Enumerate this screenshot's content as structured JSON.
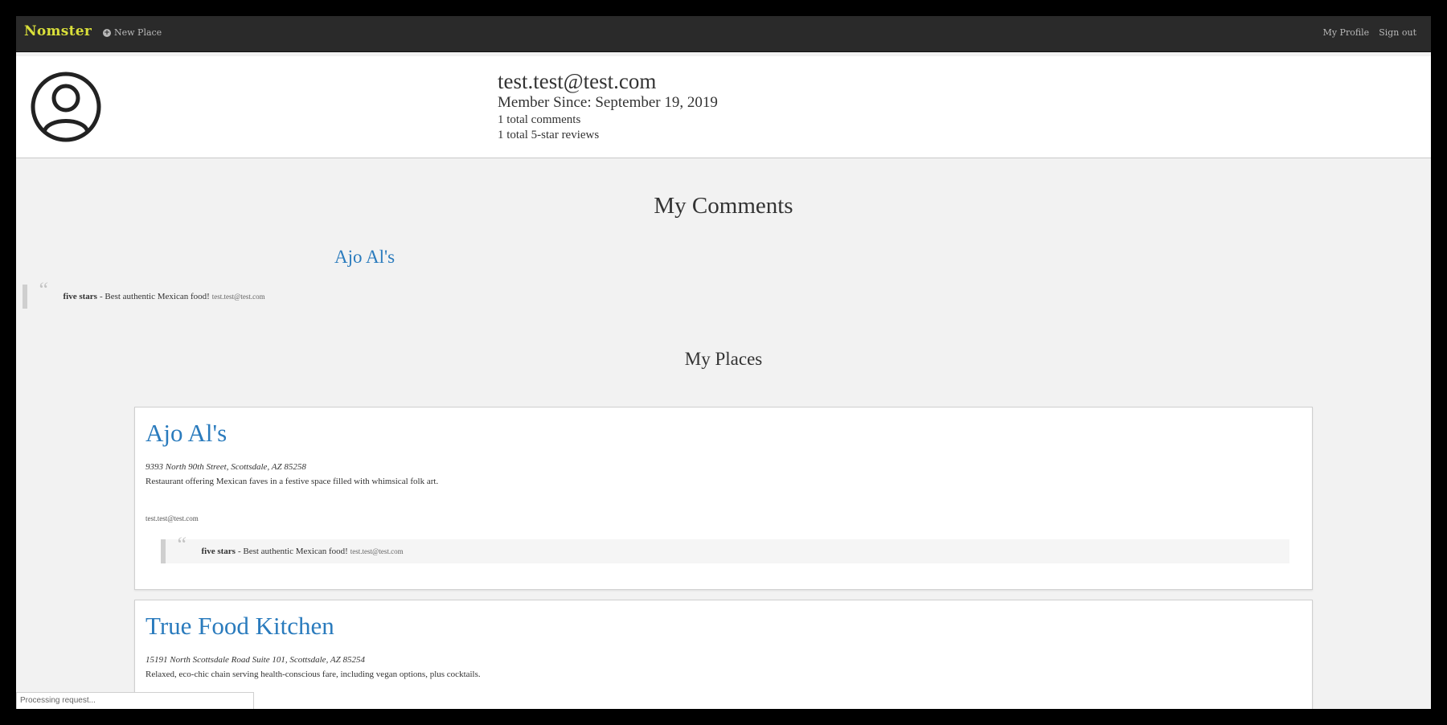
{
  "nav": {
    "brand": "Nomster",
    "new_place": "New Place",
    "my_profile": "My Profile",
    "sign_out": "Sign out"
  },
  "profile": {
    "email": "test.test@test.com",
    "member_since": "Member Since: September 19, 2019",
    "total_comments": "1 total comments",
    "total_reviews": "1 total 5-star reviews"
  },
  "comments_section": {
    "title": "My Comments",
    "items": [
      {
        "place": "Ajo Al's",
        "rating": "five stars",
        "text": "- Best authentic Mexican food!",
        "user": "test.test@test.com"
      }
    ]
  },
  "places_section": {
    "title": "My Places",
    "items": [
      {
        "name": "Ajo Al's",
        "address": "9393 North 90th Street, Scottsdale, AZ 85258",
        "description": "Restaurant offering Mexican faves in a festive space filled with whimsical folk art.",
        "owner": "test.test@test.com",
        "comment": {
          "rating": "five stars",
          "text": "- Best authentic Mexican food!",
          "user": "test.test@test.com"
        }
      },
      {
        "name": "True Food Kitchen",
        "address": "15191 North Scottsdale Road Suite 101, Scottsdale, AZ 85254",
        "description": "Relaxed, eco-chic chain serving health-conscious fare, including vegan options, plus cocktails."
      }
    ]
  },
  "status_bar": "Processing request..."
}
